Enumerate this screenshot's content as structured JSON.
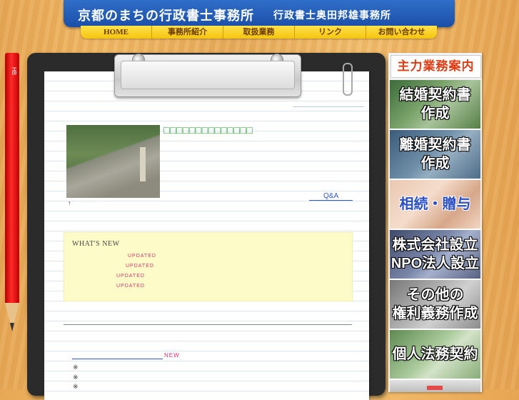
{
  "header": {
    "title": "京都のまちの行政書士事務所",
    "subtitle": "行政書士奥田邦雄事務所"
  },
  "nav": {
    "items": [
      {
        "label": "HOME"
      },
      {
        "label": "事務所紹介"
      },
      {
        "label": "取扱業務"
      },
      {
        "label": "リンク"
      },
      {
        "label": "お問い合わせ"
      }
    ]
  },
  "pencil": {
    "label": "HB"
  },
  "main": {
    "heading": "□□□□□□□□□□□□□□",
    "qa_link": "Q&A",
    "arrow": "↑",
    "news": {
      "title": "WHAT'S NEW",
      "updates": [
        "UPDATED",
        "UPDATED",
        "UPDATED",
        "UPDATED"
      ]
    },
    "new_label": "NEW",
    "bullets": [
      "※",
      "※",
      "※"
    ]
  },
  "sidebar": {
    "title": "主力業務案内",
    "buttons": [
      {
        "label": "結婚契約書\n作成"
      },
      {
        "label": "離婚契約書\n作成"
      },
      {
        "label": "相続・贈与"
      },
      {
        "label": "株式会社設立\nNPO法人設立"
      },
      {
        "label": "その他の\n権利義務作成"
      },
      {
        "label": "個人法務契約"
      }
    ]
  },
  "colors": {
    "header_blue": "#1b4fa8",
    "nav_yellow": "#f5c40f",
    "heading_green": "#1a9a2a",
    "updated_pink": "#d2346e",
    "link_blue": "#3355cc",
    "sidebar_title_red": "#e23a10"
  }
}
